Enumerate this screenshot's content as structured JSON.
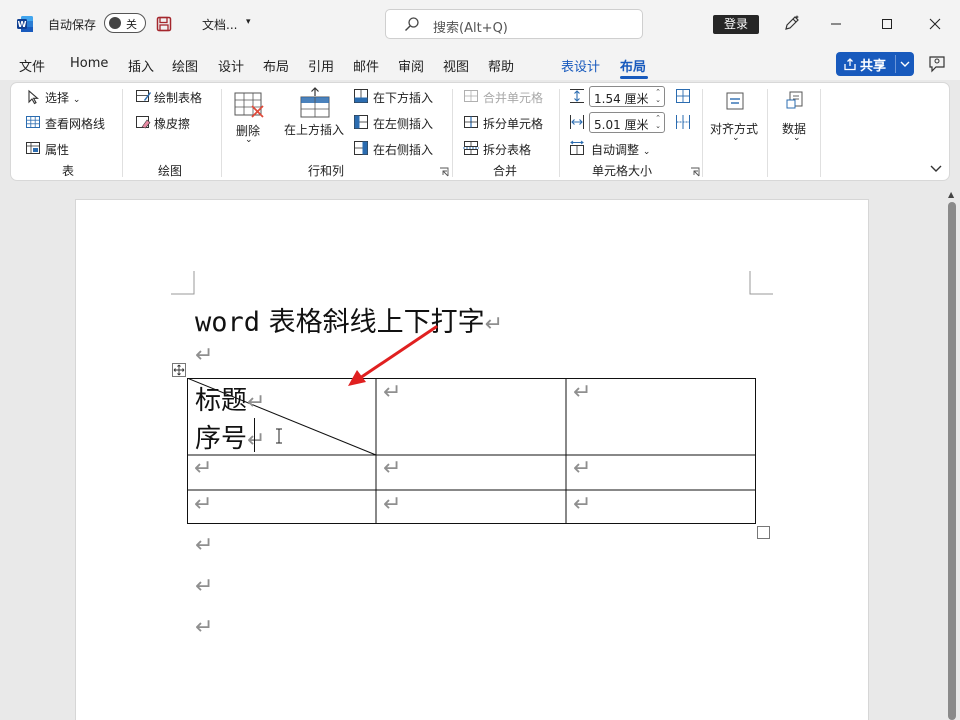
{
  "titlebar": {
    "autosave_label": "自动保存",
    "autosave_state": "关",
    "doc_title": "文档...",
    "search_placeholder": "搜索(Alt+Q)",
    "login_label": "登录"
  },
  "menu": {
    "tabs": [
      "文件",
      "Home",
      "插入",
      "绘图",
      "设计",
      "布局",
      "引用",
      "邮件",
      "审阅",
      "视图",
      "帮助"
    ],
    "context_tabs": [
      "表设计",
      "布局"
    ],
    "active_tab": "布局",
    "share_label": "共享"
  },
  "ribbon": {
    "table_group": {
      "label": "表",
      "select": "选择",
      "view_gridlines": "查看网格线",
      "properties": "属性"
    },
    "draw_group": {
      "label": "绘图",
      "draw_table": "绘制表格",
      "eraser": "橡皮擦"
    },
    "rows_cols_group": {
      "label": "行和列",
      "delete": "删除",
      "insert_above": "在上方插入",
      "insert_below": "在下方插入",
      "insert_left": "在左侧插入",
      "insert_right": "在右侧插入"
    },
    "merge_group": {
      "label": "合并",
      "merge_cells": "合并单元格",
      "split_cells": "拆分单元格",
      "split_table": "拆分表格"
    },
    "cell_size_group": {
      "label": "单元格大小",
      "height": "1.54 厘米",
      "width": "5.01 厘米",
      "autofit": "自动调整"
    },
    "align": {
      "label": "对齐方式"
    },
    "data": {
      "label": "数据"
    }
  },
  "document": {
    "heading_latin": "word",
    "heading_cjk": " 表格斜线上下打字",
    "paragraph_mark": "↵",
    "table": {
      "top_left_line1": "标题",
      "top_left_line2": "序号"
    }
  },
  "colors": {
    "accent": "#185abd",
    "annotation_arrow": "#e02020"
  }
}
